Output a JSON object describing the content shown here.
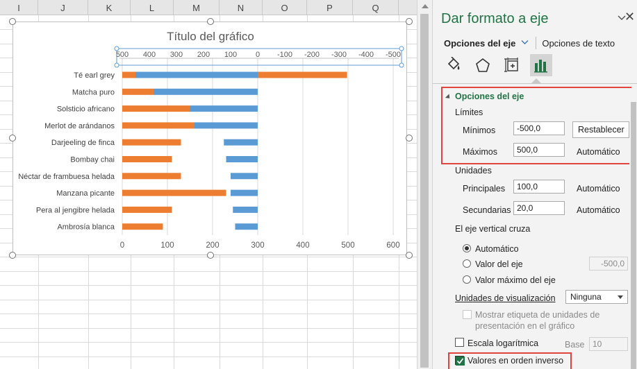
{
  "sheet": {
    "columns": [
      "I",
      "J",
      "K",
      "L",
      "M",
      "N",
      "O",
      "P",
      "Q"
    ]
  },
  "chart_data": {
    "type": "bar",
    "orientation": "horizontal",
    "stacked": true,
    "title": "Título del gráfico",
    "categories": [
      "Té earl grey",
      "Matcha puro",
      "Solsticio africano",
      "Merlot de arándanos",
      "Darjeeling de finca",
      "Bombay chai",
      "Néctar de frambuesa helada",
      "Manzana picante",
      "Pera al jengibre helada",
      "Ambrosía blanca"
    ],
    "series": [
      {
        "color": "#ed7d31",
        "values": [
          30,
          70,
          150,
          160,
          130,
          110,
          130,
          230,
          110,
          90
        ]
      },
      {
        "color": "#5b9bd5",
        "values": [
          270,
          230,
          150,
          140,
          75,
          70,
          60,
          60,
          55,
          50
        ]
      }
    ],
    "primary_x_axis": {
      "ticks": [
        "0",
        "100",
        "200",
        "300",
        "400",
        "500",
        "600"
      ],
      "range": [
        0,
        600
      ]
    },
    "secondary_x_axis": {
      "ticks": [
        "500",
        "400",
        "300",
        "200",
        "100",
        "0",
        "-100",
        "-200",
        "-300",
        "-400",
        "-500"
      ],
      "range": [
        -500,
        500
      ],
      "reversed": true
    },
    "secondary_series": [
      {
        "color": "#ed7d31",
        "values": [
          -330,
          0,
          0,
          0,
          0,
          0,
          0,
          0,
          0,
          0
        ]
      }
    ],
    "grid": true,
    "legend": "none"
  },
  "pane": {
    "title": "Dar formato a eje",
    "tab_axis": "Opciones del eje",
    "tab_text": "Opciones de texto",
    "icons": [
      "paint-bucket-icon",
      "pentagon-icon",
      "size-properties-icon",
      "bar-chart-icon"
    ],
    "section_title": "Opciones del eje",
    "limits_label": "Límites",
    "min_label": "Mínimos",
    "min_value": "-500,0",
    "reset_button": "Restablecer",
    "max_label": "Máximos",
    "max_value": "500,0",
    "max_state": "Automático",
    "units_label": "Unidades",
    "major_label": "Principales",
    "major_value": "100,0",
    "major_state": "Automático",
    "minor_label": "Secundarias",
    "minor_value": "20,0",
    "minor_state": "Automático",
    "cross_label": "El eje vertical cruza",
    "radio_auto": "Automático",
    "radio_value": "Valor del eje",
    "radio_value_input": "-500,0",
    "radio_max": "Valor máximo del eje",
    "display_units_label": "Unidades de visualización",
    "display_units_value": "Ninguna",
    "show_units_label_line1": "Mostrar etiqueta de unidades de",
    "show_units_label_line2": "presentación en el gráfico",
    "log_scale_label": "Escala logarítmica",
    "base_label": "Base",
    "base_value": "10",
    "reverse_order_label": "Valores en orden inverso",
    "accent_color": "#217346",
    "highlight_color": "#e0443c"
  }
}
